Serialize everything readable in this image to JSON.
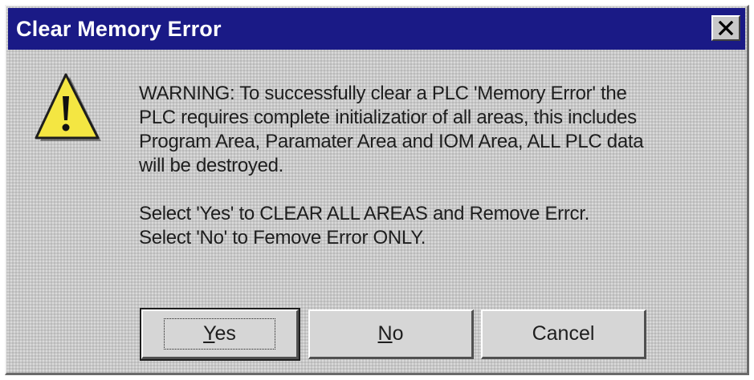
{
  "dialog": {
    "title": "Clear Memory Error",
    "close_glyph": "✕",
    "icon": "warning-icon",
    "title_bar_color": "#1a1a86",
    "message": {
      "lines_1": [
        "WARNING: To successfully clear a PLC 'Memory Error' the",
        "PLC requires complete initializatior of all areas, this includes",
        "Program Area, Paramater Area and IOM Area, ALL PLC data",
        "will be destroyed."
      ],
      "lines_2": [
        "Select 'Yes' to CLEAR ALL AREAS and Remove Errcr.",
        "Select 'No' to Femove Error ONLY."
      ]
    },
    "buttons": {
      "yes": {
        "accel": "Y",
        "rest": "es"
      },
      "no": {
        "accel": "N",
        "rest": "o"
      },
      "cancel": {
        "label": "Cancel"
      }
    }
  }
}
